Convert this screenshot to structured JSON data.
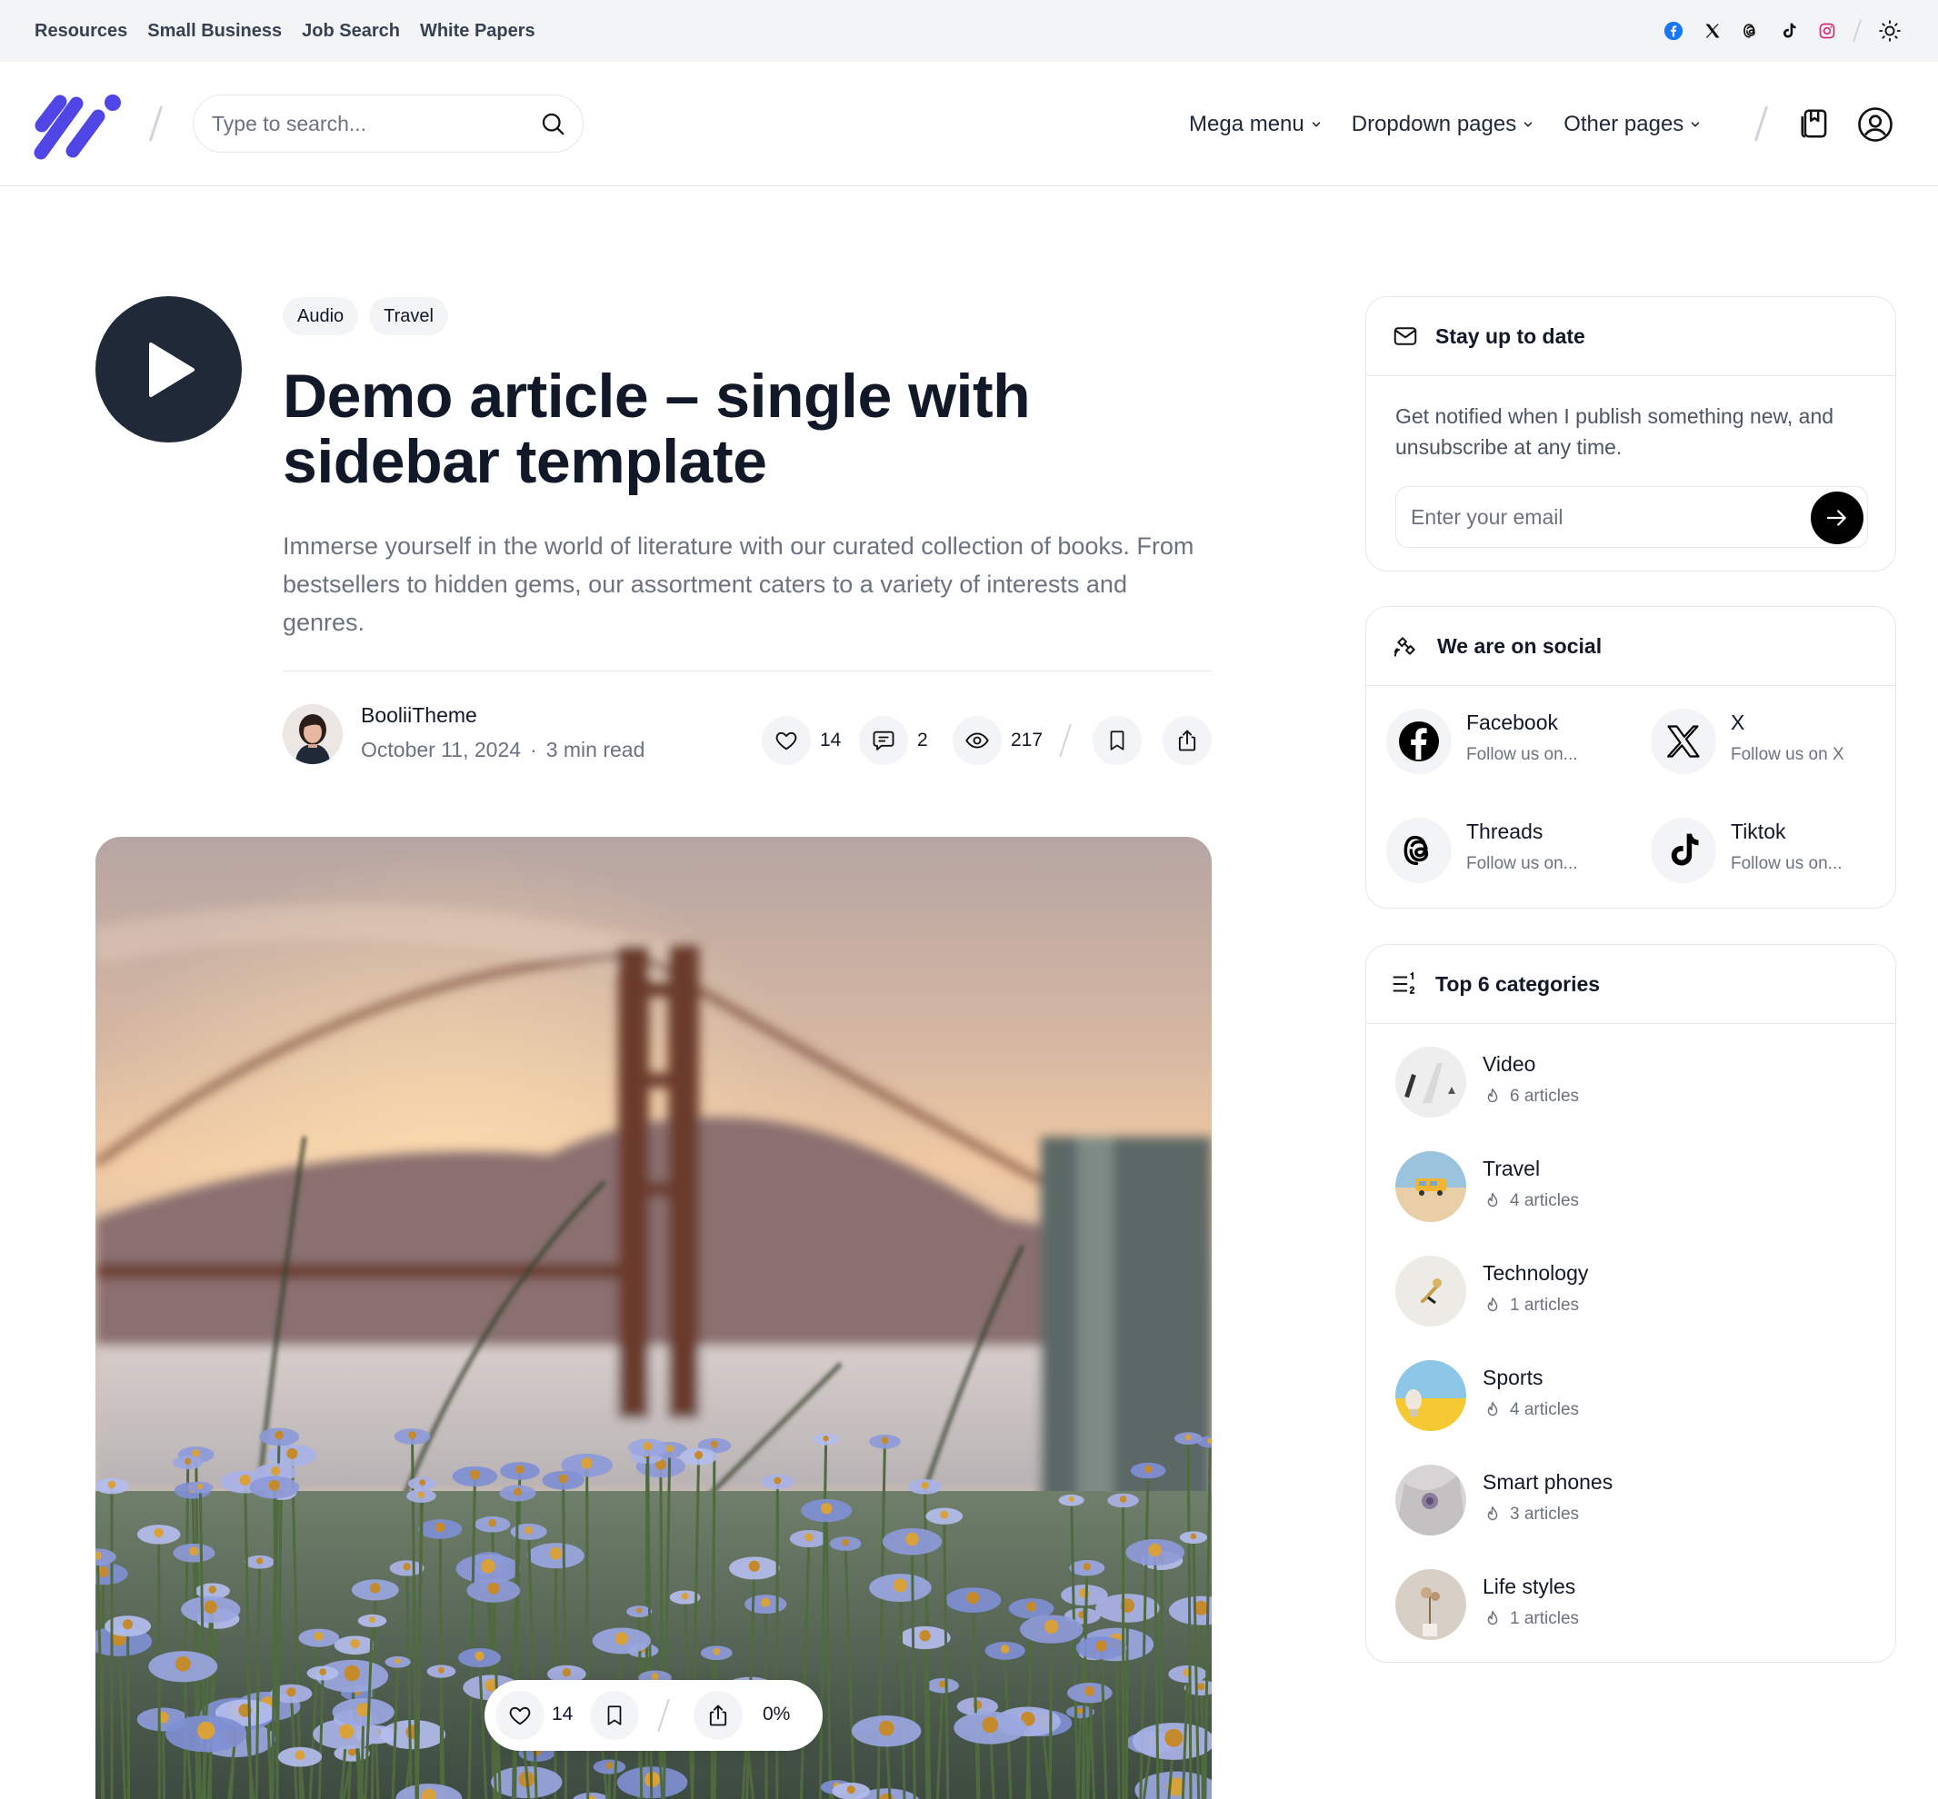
{
  "topbar": {
    "links": [
      "Resources",
      "Small Business",
      "Job Search",
      "White Papers"
    ],
    "social_icons": [
      "facebook-icon",
      "x-icon",
      "threads-icon",
      "tiktok-icon",
      "instagram-icon"
    ],
    "theme_icon": "sun-icon"
  },
  "header": {
    "search_placeholder": "Type to search...",
    "nav": [
      "Mega menu",
      "Dropdown pages",
      "Other pages"
    ],
    "brand_color": "#4f46e5"
  },
  "article": {
    "tags": [
      "Audio",
      "Travel"
    ],
    "title": "Demo article – single with sidebar template",
    "excerpt": "Immerse yourself in the world of literature with our curated collection of books. From bestsellers to hidden gems, our assortment caters to a variety of interests and genres.",
    "author": "BooliiTheme",
    "date": "October 11, 2024",
    "dot": "·",
    "read_time": "3 min read",
    "likes": "14",
    "comments": "2",
    "views": "217"
  },
  "floating_bar": {
    "likes": "14",
    "progress": "0%"
  },
  "newsletter": {
    "title": "Stay up to date",
    "text": "Get notified when I publish something new, and unsubscribe at any time.",
    "placeholder": "Enter your email"
  },
  "social": {
    "title": "We are on social",
    "items": [
      {
        "name": "Facebook",
        "sub": "Follow us on..."
      },
      {
        "name": "X",
        "sub": "Follow us on X"
      },
      {
        "name": "Threads",
        "sub": "Follow us on..."
      },
      {
        "name": "Tiktok",
        "sub": "Follow us on..."
      }
    ]
  },
  "categories": {
    "title": "Top 6 categories",
    "items": [
      {
        "name": "Video",
        "count": "6 articles"
      },
      {
        "name": "Travel",
        "count": "4 articles"
      },
      {
        "name": "Technology",
        "count": "1 articles"
      },
      {
        "name": "Sports",
        "count": "4 articles"
      },
      {
        "name": "Smart phones",
        "count": "3 articles"
      },
      {
        "name": "Life styles",
        "count": "1 articles"
      }
    ]
  }
}
